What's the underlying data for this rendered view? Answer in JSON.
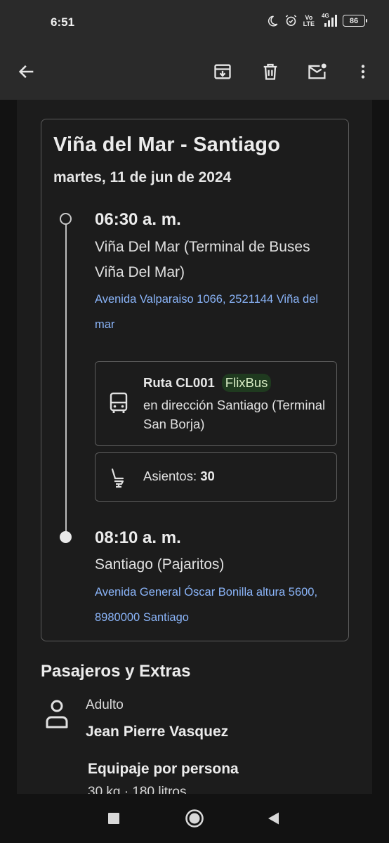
{
  "status_bar": {
    "time": "6:51",
    "volte_line1": "Vo",
    "volte_line2": "LTE",
    "network": "4G",
    "battery": "86"
  },
  "toolbar": {
    "back_icon": "arrow-left-icon",
    "archive_icon": "archive-icon",
    "delete_icon": "trash-icon",
    "mark_unread_icon": "mail-unread-icon",
    "more_icon": "more-vert-icon"
  },
  "trip": {
    "title": "Viña del Mar - Santiago",
    "date": "martes, 11 de jun de 2024",
    "departure": {
      "time": "06:30 a. m.",
      "station": "Viña Del Mar (Terminal de Buses Viña Del Mar)",
      "address": "Avenida Valparaiso 1066, 2521144 Viña del mar"
    },
    "route": {
      "label": "Ruta CL001",
      "operator": "FlixBus",
      "direction": "en dirección Santiago (Terminal San Borja)"
    },
    "seats": {
      "label": "Asientos:",
      "value": "30"
    },
    "arrival": {
      "time": "08:10 a. m.",
      "station": "Santiago (Pajaritos)",
      "address": "Avenida General Óscar Bonilla altura 5600, 8980000 Santiago"
    }
  },
  "passengers": {
    "section_title": "Pasajeros y Extras",
    "items": [
      {
        "type": "Adulto",
        "name": "Jean Pierre Vasquez",
        "baggage_title": "Equipaje por persona",
        "baggage_detail": "30 kg · 180 litros"
      }
    ]
  },
  "colors": {
    "link": "#8ab4f8",
    "chip_bg": "#1f3a1f",
    "chip_text": "#d7ecc4",
    "surface": "#1c1c1c",
    "appbar": "#2a2a2a"
  }
}
